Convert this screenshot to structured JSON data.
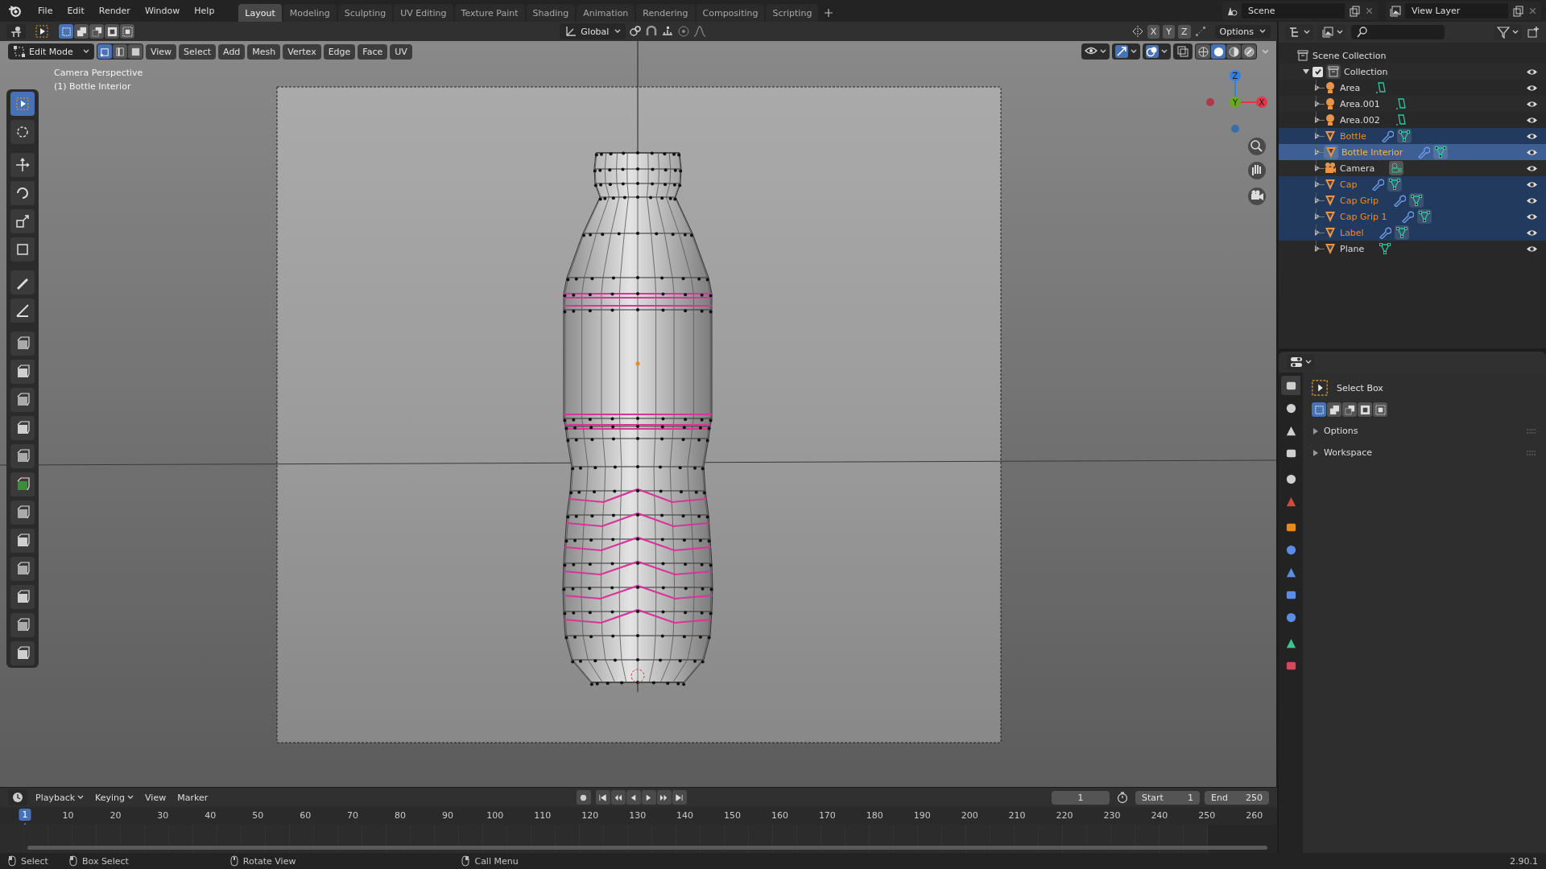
{
  "menu": [
    "File",
    "Edit",
    "Render",
    "Window",
    "Help"
  ],
  "workspaces": [
    {
      "label": "Layout",
      "selected": true
    },
    {
      "label": "Modeling",
      "selected": false
    },
    {
      "label": "Sculpting",
      "selected": false
    },
    {
      "label": "UV Editing",
      "selected": false
    },
    {
      "label": "Texture Paint",
      "selected": false
    },
    {
      "label": "Shading",
      "selected": false
    },
    {
      "label": "Animation",
      "selected": false
    },
    {
      "label": "Rendering",
      "selected": false
    },
    {
      "label": "Compositing",
      "selected": false
    },
    {
      "label": "Scripting",
      "selected": false
    }
  ],
  "scene": "Scene",
  "view_layer": "View Layer",
  "viewport": {
    "orientation": "Global",
    "axes": [
      "X",
      "Y",
      "Z"
    ],
    "options": "Options",
    "mode": "Edit Mode",
    "menus": [
      "View",
      "Select",
      "Add",
      "Mesh",
      "Vertex",
      "Edge",
      "Face",
      "UV"
    ],
    "camera_label": "Camera Perspective",
    "object_label": "(1) Bottle Interior",
    "gizmo": [
      {
        "label": "Z",
        "color": "#2f83e6"
      },
      {
        "label": "Y",
        "color": "#6ba81f"
      },
      {
        "label": "X",
        "color": "#e8344a"
      }
    ]
  },
  "outliner": {
    "root": "Scene Collection",
    "collection": {
      "name": "Collection",
      "checked": true,
      "expanded": true,
      "children": [
        {
          "name": "Area",
          "kind": "light",
          "selected": false,
          "active": false,
          "modifier": false
        },
        {
          "name": "Area.001",
          "kind": "light",
          "selected": false,
          "active": false,
          "modifier": false
        },
        {
          "name": "Area.002",
          "kind": "light",
          "selected": false,
          "active": false,
          "modifier": false
        },
        {
          "name": "Bottle",
          "kind": "mesh",
          "selected": true,
          "active": false,
          "modifier": true
        },
        {
          "name": "Bottle Interior",
          "kind": "mesh",
          "selected": true,
          "active": true,
          "modifier": true
        },
        {
          "name": "Camera",
          "kind": "camera",
          "selected": false,
          "active": false,
          "modifier": false
        },
        {
          "name": "Cap",
          "kind": "mesh",
          "selected": true,
          "active": false,
          "modifier": true
        },
        {
          "name": "Cap Grip",
          "kind": "mesh",
          "selected": true,
          "active": false,
          "modifier": true
        },
        {
          "name": "Cap Grip 1",
          "kind": "mesh",
          "selected": true,
          "active": false,
          "modifier": true
        },
        {
          "name": "Label",
          "kind": "mesh",
          "selected": true,
          "active": false,
          "modifier": true
        },
        {
          "name": "Plane",
          "kind": "mesh",
          "selected": false,
          "active": false,
          "modifier": false
        }
      ]
    }
  },
  "properties": {
    "tool": "Select Box",
    "sections": [
      "Options",
      "Workspace"
    ]
  },
  "timeline": {
    "menus": [
      "Playback",
      "Keying",
      "View",
      "Marker"
    ],
    "current_frame": "1",
    "start_label": "Start",
    "start": "1",
    "end_label": "End",
    "end": "250",
    "ticks": [
      "1",
      "10",
      "20",
      "30",
      "40",
      "50",
      "60",
      "70",
      "80",
      "90",
      "100",
      "110",
      "120",
      "130",
      "140",
      "150",
      "160",
      "170",
      "180",
      "190",
      "200",
      "210",
      "220",
      "230",
      "240",
      "250",
      "260"
    ]
  },
  "status_bar": {
    "items": [
      "Select",
      "Box Select",
      "Rotate View",
      "Call Menu"
    ],
    "version": "2.90.1"
  }
}
